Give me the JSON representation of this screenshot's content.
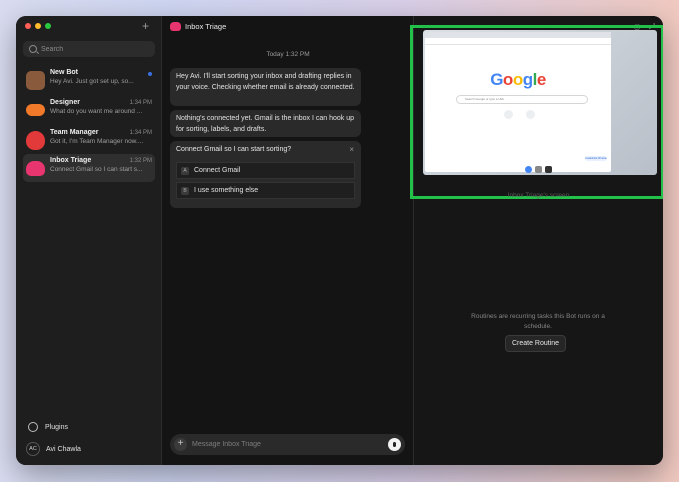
{
  "sidebar": {
    "new_chat_symbol": "+",
    "search_placeholder": "Search",
    "chats": [
      {
        "name": "New Bot",
        "time": "",
        "preview": "Hey Avi. Just got set up, so...",
        "color": "#8a5a3c",
        "unread": true
      },
      {
        "name": "Designer",
        "time": "1:34 PM",
        "preview": "What do you want me around ...",
        "color": "#f07a2a"
      },
      {
        "name": "Team Manager",
        "time": "1:34 PM",
        "preview": "Got it, I'm Team Manager now....",
        "color": "#e23a3a"
      },
      {
        "name": "Inbox Triage",
        "time": "1:32 PM",
        "preview": "Connect Gmail so I can start s...",
        "color": "#e8346f",
        "active": true
      }
    ],
    "plugins_label": "Plugins",
    "user_initials": "AC",
    "user_name": "Avi Chawla"
  },
  "chat": {
    "title": "Inbox Triage",
    "date_label": "Today 1:32 PM",
    "messages": [
      "Hey Avi. I'll start sorting your inbox and drafting replies in your voice. Checking whether email is already connected.",
      "Nothing's connected yet. Gmail is the inbox I can hook up for sorting, labels, and drafts."
    ],
    "prompt": {
      "title": "Connect Gmail so I can start sorting?",
      "close_symbol": "×",
      "options": [
        {
          "key": "A",
          "label": "Connect Gmail"
        },
        {
          "key": "B",
          "label": "I use something else"
        }
      ]
    },
    "composer_placeholder": "Message Inbox Triage",
    "composer_plus": "+"
  },
  "right_panel": {
    "screen_caption": "Inbox Triage's screen",
    "google_logo": "Google",
    "google_search_placeholder": "Search Google or type a URL",
    "customize_label": "Customize Chrome",
    "routines_text": "Routines are recurring tasks this Bot runs on a schedule.",
    "create_routine_label": "Create Routine",
    "highlight_color": "#22c24a"
  }
}
